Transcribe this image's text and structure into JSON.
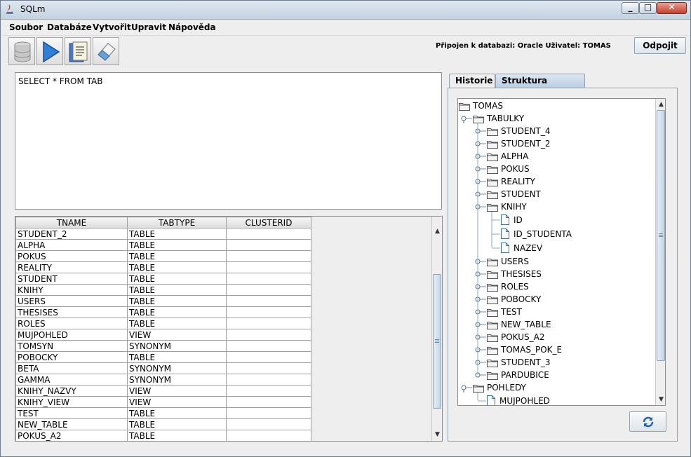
{
  "window": {
    "title": "SQLm",
    "min_icon": "minimize-icon",
    "max_icon": "maximize-icon",
    "close_icon": "close-icon"
  },
  "menu": [
    "Soubor",
    "Databáze",
    "Vytvořit",
    "Upravit",
    "Nápověda"
  ],
  "toolbar": {
    "icons": [
      "database-icon",
      "play-icon",
      "document-icon",
      "eraser-icon"
    ]
  },
  "status": "Připojen k databazi: Oracle  Uživatel: TOMAS",
  "disconnect_label": "Odpojit",
  "editor": {
    "text": "SELECT * FROM TAB"
  },
  "results": {
    "columns": [
      "TNAME",
      "TABTYPE",
      "CLUSTERID"
    ],
    "rows": [
      [
        "STUDENT_2",
        "TABLE",
        ""
      ],
      [
        "ALPHA",
        "TABLE",
        ""
      ],
      [
        "POKUS",
        "TABLE",
        ""
      ],
      [
        "REALITY",
        "TABLE",
        ""
      ],
      [
        "STUDENT",
        "TABLE",
        ""
      ],
      [
        "KNIHY",
        "TABLE",
        ""
      ],
      [
        "USERS",
        "TABLE",
        ""
      ],
      [
        "THESISES",
        "TABLE",
        ""
      ],
      [
        "ROLES",
        "TABLE",
        ""
      ],
      [
        "MUJPOHLED",
        "VIEW",
        ""
      ],
      [
        "TOMSYN",
        "SYNONYM",
        ""
      ],
      [
        "POBOCKY",
        "TABLE",
        ""
      ],
      [
        "BETA",
        "SYNONYM",
        ""
      ],
      [
        "GAMMA",
        "SYNONYM",
        ""
      ],
      [
        "KNIHY_NAZVY",
        "VIEW",
        ""
      ],
      [
        "KNIHY_VIEW",
        "VIEW",
        ""
      ],
      [
        "TEST",
        "TABLE",
        ""
      ],
      [
        "NEW_TABLE",
        "TABLE",
        ""
      ],
      [
        "POKUS_A2",
        "TABLE",
        ""
      ]
    ]
  },
  "tabs": {
    "history": "Historie",
    "structure": "Struktura databáze"
  },
  "tree": {
    "root": "TOMAS",
    "tables_label": "TABULKY",
    "tables": [
      "STUDENT_4",
      "STUDENT_2",
      "ALPHA",
      "POKUS",
      "REALITY",
      "STUDENT",
      "KNIHY"
    ],
    "knihy_columns": [
      "ID",
      "ID_STUDENTA",
      "NAZEV"
    ],
    "tables_after": [
      "USERS",
      "THESISES",
      "ROLES",
      "POBOCKY",
      "TEST",
      "NEW_TABLE",
      "POKUS_A2",
      "TOMAS_POK_E",
      "STUDENT_3",
      "PARDUBICE"
    ],
    "views_label": "POHLEDY",
    "views": [
      "MUJPOHLED"
    ]
  },
  "refresh_icon": "refresh-icon"
}
